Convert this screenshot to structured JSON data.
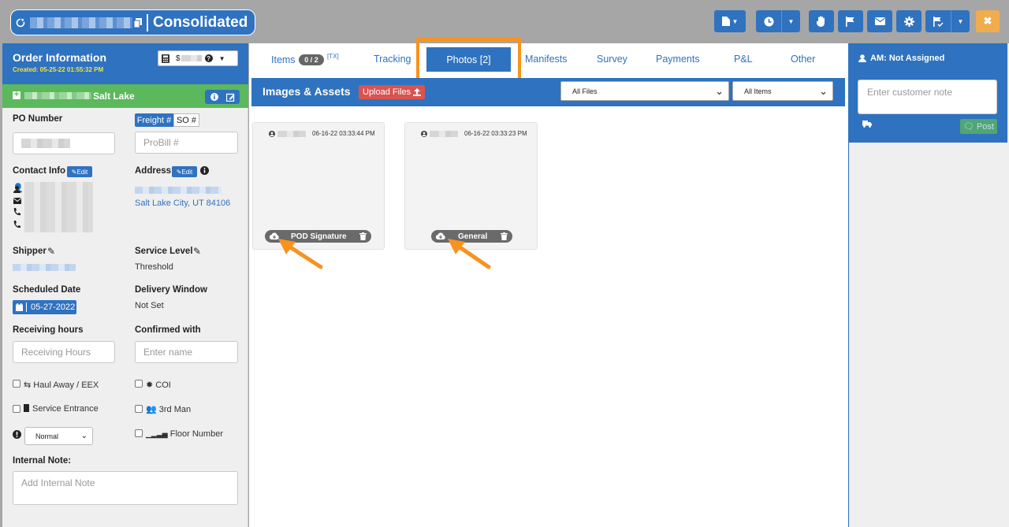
{
  "header": {
    "title": "Consolidated",
    "close_label": "✖"
  },
  "order": {
    "heading": "Order Information",
    "created": "Created: 05-25-22 01:55:32 PM",
    "account_value": "$",
    "location": "Salt Lake",
    "po_label": "PO Number",
    "freight_label": "Freight #",
    "so_label": "SO #",
    "probill_placeholder": "ProBill #",
    "contact_label": "Contact Info",
    "edit_label": "Edit",
    "address_label": "Address",
    "address_city": "Salt Lake City, UT 84106",
    "shipper_label": "Shipper",
    "service_level_label": "Service Level",
    "service_level_value": "Threshold",
    "scheduled_label": "Scheduled Date",
    "scheduled_value": "05-27-2022",
    "window_label": "Delivery Window",
    "window_value": "Not Set",
    "receiving_label": "Receiving hours",
    "receiving_placeholder": "Receiving Hours",
    "confirmed_label": "Confirmed with",
    "confirmed_placeholder": "Enter name",
    "haul_away": "Haul Away / EEX",
    "coi": "COI",
    "service_entrance": "Service Entrance",
    "third_man": "3rd Man",
    "priority_value": "Normal",
    "floor_number": "Floor Number",
    "internal_note_label": "Internal Note:",
    "internal_note_placeholder": "Add Internal Note"
  },
  "tabs": {
    "items": "Items",
    "items_badge": "0 / 2",
    "items_tx": "[TX]",
    "tracking": "Tracking",
    "photos": "Photos [2]",
    "manifests": "Manifests",
    "survey": "Survey",
    "payments": "Payments",
    "pl": "P&L",
    "other": "Other"
  },
  "assets": {
    "title": "Images & Assets",
    "upload_label": "Upload Files",
    "filter_files": "All Files",
    "filter_items": "All Items",
    "cards": [
      {
        "timestamp": "06-16-22 03:33:44 PM",
        "caption": "POD Signature"
      },
      {
        "timestamp": "06-16-22 03:33:23 PM",
        "caption": "General"
      }
    ]
  },
  "notes": {
    "am_label": "AM: Not Assigned",
    "customer_placeholder": "Enter customer note",
    "post_label": "Post"
  },
  "colors": {
    "primary": "#2f72c0",
    "highlight": "#f7931e",
    "success": "#5cb85c",
    "danger": "#d9534f"
  }
}
